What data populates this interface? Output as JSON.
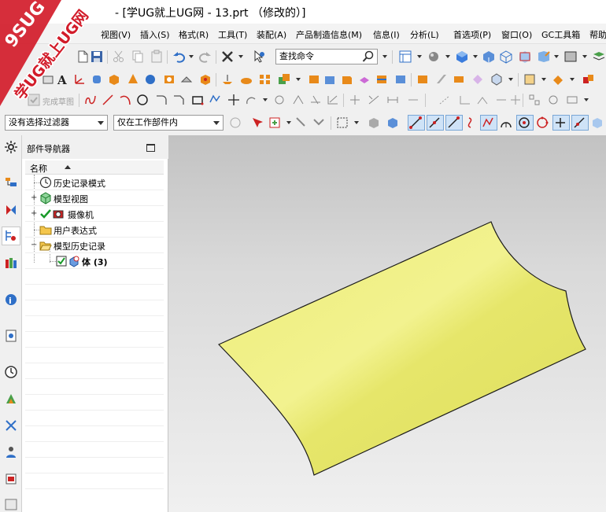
{
  "window": {
    "title": "- [学UG就上UG网 - 13.prt （修改的）]"
  },
  "watermark": {
    "line1": "9SUG",
    "line2": "学UG就上UG网",
    "color": "#d21c2a"
  },
  "menu": {
    "items": [
      "视图(V)",
      "插入(S)",
      "格式(R)",
      "工具(T)",
      "装配(A)",
      "产品制造信息(M)",
      "信息(I)",
      "分析(L)",
      "首选项(P)",
      "窗口(O)",
      "GC工具箱",
      "帮助"
    ]
  },
  "toolbar": {
    "command_search_placeholder": "查找命令",
    "finish_sketch_label": "完成草图",
    "selection_filter": "没有选择过滤器",
    "selection_scope": "仅在工作部件内"
  },
  "navigator": {
    "title": "部件导航器",
    "column_name": "名称",
    "items": [
      {
        "label": "历史记录模式",
        "icon": "clock-icon"
      },
      {
        "label": "模型视图",
        "icon": "model-views-icon"
      },
      {
        "label": "摄像机",
        "icon": "camera-icon"
      },
      {
        "label": "用户表达式",
        "icon": "folder-icon"
      },
      {
        "label": "模型历史记录",
        "icon": "open-folder-icon"
      },
      {
        "label": "体 (3)",
        "icon": "body-icon"
      }
    ]
  },
  "viewport": {
    "background_top": "#c2c2c2",
    "background_bottom": "#f0f0f0",
    "surface_color": "#e8e86a",
    "edge_color": "#1a1a1a"
  },
  "colors": {
    "accent_blue": "#2f6fc7",
    "accent_red": "#cc2222",
    "accent_green": "#1a9a2a",
    "accent_orange": "#e88a1a"
  }
}
